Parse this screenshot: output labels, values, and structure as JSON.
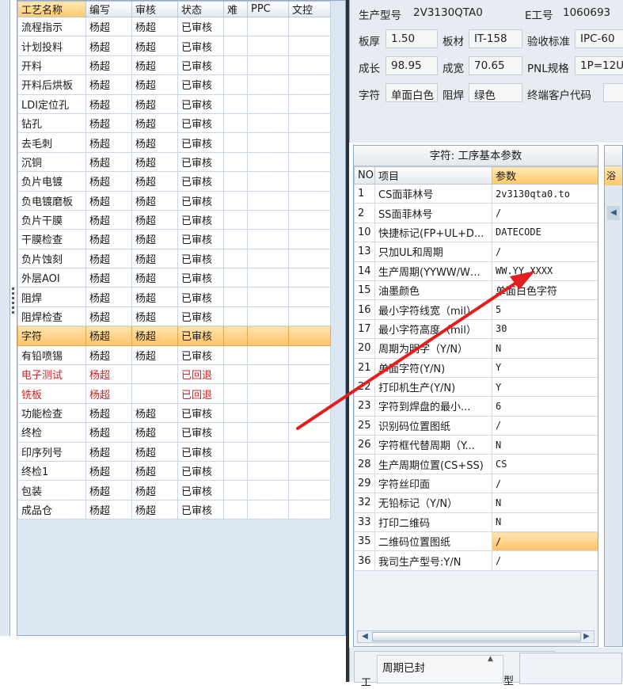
{
  "process_table": {
    "columns": [
      "工艺名称",
      "编写",
      "审核",
      "状态",
      "难",
      "PPC",
      "文控"
    ],
    "rows": [
      {
        "name": "流程指示",
        "author": "杨超",
        "reviewer": "杨超",
        "status": "已审核"
      },
      {
        "name": "计划投料",
        "author": "杨超",
        "reviewer": "杨超",
        "status": "已审核"
      },
      {
        "name": "开料",
        "author": "杨超",
        "reviewer": "杨超",
        "status": "已审核"
      },
      {
        "name": "开料后烘板",
        "author": "杨超",
        "reviewer": "杨超",
        "status": "已审核"
      },
      {
        "name": "LDI定位孔",
        "author": "杨超",
        "reviewer": "杨超",
        "status": "已审核"
      },
      {
        "name": "钻孔",
        "author": "杨超",
        "reviewer": "杨超",
        "status": "已审核"
      },
      {
        "name": "去毛刺",
        "author": "杨超",
        "reviewer": "杨超",
        "status": "已审核"
      },
      {
        "name": "沉铜",
        "author": "杨超",
        "reviewer": "杨超",
        "status": "已审核"
      },
      {
        "name": "负片电镀",
        "author": "杨超",
        "reviewer": "杨超",
        "status": "已审核"
      },
      {
        "name": "负电镀磨板",
        "author": "杨超",
        "reviewer": "杨超",
        "status": "已审核"
      },
      {
        "name": "负片干膜",
        "author": "杨超",
        "reviewer": "杨超",
        "status": "已审核"
      },
      {
        "name": "干膜检查",
        "author": "杨超",
        "reviewer": "杨超",
        "status": "已审核"
      },
      {
        "name": "负片蚀刻",
        "author": "杨超",
        "reviewer": "杨超",
        "status": "已审核"
      },
      {
        "name": "外层AOI",
        "author": "杨超",
        "reviewer": "杨超",
        "status": "已审核"
      },
      {
        "name": "阻焊",
        "author": "杨超",
        "reviewer": "杨超",
        "status": "已审核"
      },
      {
        "name": "阻焊检查",
        "author": "杨超",
        "reviewer": "杨超",
        "status": "已审核"
      },
      {
        "name": "字符",
        "author": "杨超",
        "reviewer": "杨超",
        "status": "已审核",
        "selected": true
      },
      {
        "name": "有铅喷锡",
        "author": "杨超",
        "reviewer": "杨超",
        "status": "已审核"
      },
      {
        "name": "电子测试",
        "author": "杨超",
        "reviewer": "",
        "status": "已回退",
        "red": true
      },
      {
        "name": "铣板",
        "author": "杨超",
        "reviewer": "",
        "status": "已回退",
        "red": true
      },
      {
        "name": "功能检查",
        "author": "杨超",
        "reviewer": "杨超",
        "status": "已审核"
      },
      {
        "name": "终检",
        "author": "杨超",
        "reviewer": "杨超",
        "status": "已审核"
      },
      {
        "name": "印序列号",
        "author": "杨超",
        "reviewer": "杨超",
        "status": "已审核"
      },
      {
        "name": "终检1",
        "author": "杨超",
        "reviewer": "杨超",
        "status": "已审核"
      },
      {
        "name": "包装",
        "author": "杨超",
        "reviewer": "杨超",
        "status": "已审核"
      },
      {
        "name": "成品仓",
        "author": "杨超",
        "reviewer": "杨超",
        "status": "已审核"
      }
    ]
  },
  "info": {
    "model_label": "生产型号",
    "model_value": "2V3130QTA0",
    "eno_label": "E工号",
    "eno_value": "1060693",
    "thickness_label": "板厚",
    "thickness_value": "1.50",
    "material_label": "板材",
    "material_value": "IT-158",
    "standard_label": "验收标准",
    "standard_value": "IPC-60",
    "grow_label": "成长",
    "grow_value": "98.95",
    "width_label": "成宽",
    "width_value": "70.65",
    "pnl_label": "PNL规格",
    "pnl_value": "1P=12U",
    "char_label": "字符",
    "char_value": "单面白色",
    "mask_label": "阻焊",
    "mask_value": "绿色",
    "customer_label": "终端客户代码",
    "customer_value": ""
  },
  "param_grid": {
    "title": "字符: 工序基本参数",
    "columns": [
      "NO",
      "项目",
      "参数"
    ],
    "rows": [
      {
        "no": "1",
        "item": "CS面菲林号",
        "value": "2v3130qta0.to"
      },
      {
        "no": "2",
        "item": "SS面菲林号",
        "value": "/"
      },
      {
        "no": "10",
        "item": "快捷标记(FP+UL+D...",
        "value": "DATECODE"
      },
      {
        "no": "13",
        "item": "只加UL和周期",
        "value": "/"
      },
      {
        "no": "14",
        "item": "生产周期(YYWW/WWYY)",
        "value": "WW.YY.XXXX"
      },
      {
        "no": "15",
        "item": "油墨颜色",
        "value": "单面白色字符"
      },
      {
        "no": "16",
        "item": "最小字符线宽（mil）",
        "value": "5"
      },
      {
        "no": "17",
        "item": "最小字符高度（mil）",
        "value": "30"
      },
      {
        "no": "20",
        "item": "周期为明字（Y/N）",
        "value": "N"
      },
      {
        "no": "21",
        "item": "单面字符(Y/N)",
        "value": "Y"
      },
      {
        "no": "22",
        "item": "打印机生产(Y/N)",
        "value": "Y"
      },
      {
        "no": "23",
        "item": "字符到焊盘的最小...",
        "value": "6"
      },
      {
        "no": "25",
        "item": "识别码位置图纸",
        "value": "/"
      },
      {
        "no": "26",
        "item": "字符框代替周期（Y...",
        "value": "N"
      },
      {
        "no": "28",
        "item": "生产周期位置(CS+SS)",
        "value": "CS"
      },
      {
        "no": "29",
        "item": "字符丝印面",
        "value": "/"
      },
      {
        "no": "32",
        "item": "无铅标记（Y/N）",
        "value": "N"
      },
      {
        "no": "33",
        "item": "打印二维码",
        "value": "N"
      },
      {
        "no": "35",
        "item": "二维码位置图纸",
        "value": "/",
        "highlight": true
      },
      {
        "no": "36",
        "item": "我司生产型号:Y/N",
        "value": "/"
      }
    ]
  },
  "side_panel": {
    "header_fragment": "浴"
  },
  "bottom": {
    "memo_value": "周期已封",
    "left_label": "工",
    "right_label": "型"
  },
  "scroll_icons": {
    "left": "triangle-left",
    "right": "triangle-right",
    "center": "grip"
  },
  "annotation": {
    "arrow_color": "#e02020"
  }
}
